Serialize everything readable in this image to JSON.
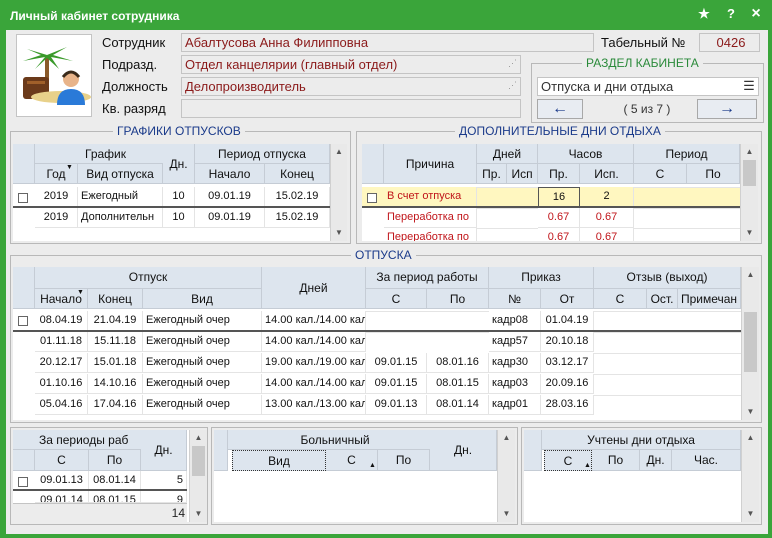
{
  "window": {
    "title": "Личный кабинет сотрудника",
    "icons": [
      "star-icon",
      "help-icon",
      "close-icon"
    ],
    "help": "?",
    "close": "×",
    "star": "★",
    "accent": "#3aa53a"
  },
  "employee": {
    "name_label": "Сотрудник",
    "name": "Абалтусова Анна Филипповна",
    "dept_label": "Подразд.",
    "dept": "Отдел канцелярии (главный отдел)",
    "pos_label": "Должность",
    "pos": "Делопроизводитель",
    "rank_label": "Кв. разряд",
    "rank": "",
    "tab_label": "Табельный №",
    "tab_no": "0426"
  },
  "cabinet": {
    "title": "РАЗДЕЛ КАБИНЕТА",
    "section": "Отпуска и дни отдыха",
    "counter": "( 5 из 7 )",
    "prev": "←",
    "next": "→",
    "menu": "☰"
  },
  "schedules": {
    "title": "ГРАФИКИ ОТПУСКОВ",
    "h_graph": "График",
    "h_year": "Год",
    "h_type": "Вид отпуска",
    "h_days": "Дн.",
    "h_period": "Период отпуска",
    "h_start": "Начало",
    "h_end": "Конец",
    "rows": [
      {
        "year": "2019",
        "type": "Ежегодный",
        "days": "10",
        "start": "09.01.19",
        "end": "15.02.19"
      },
      {
        "year": "2019",
        "type": "Дополнительн",
        "days": "10",
        "start": "09.01.19",
        "end": "15.02.19"
      }
    ]
  },
  "extra": {
    "title": "ДОПОЛНИТЕЛЬНЫЕ ДНИ ОТДЫХА",
    "h_reason": "Причина",
    "h_days": "Дней",
    "h_hours": "Часов",
    "h_period": "Период",
    "h_pr": "Пр.",
    "h_isp": "Исп",
    "h_pr2": "Пр.",
    "h_isp2": "Исп.",
    "h_from": "С",
    "h_to": "По",
    "rows": [
      {
        "reason": "В счет отпуска",
        "d_pr": "",
        "d_isp": "",
        "h_pr": "16",
        "h_isp": "2",
        "from": "",
        "to": ""
      },
      {
        "reason": "Переработка по",
        "d_pr": "",
        "d_isp": "",
        "h_pr": "0.67",
        "h_isp": "0.67",
        "from": "",
        "to": ""
      },
      {
        "reason": "Переработка по",
        "d_pr": "",
        "d_isp": "",
        "h_pr": "0.67",
        "h_isp": "0.67",
        "from": "",
        "to": ""
      }
    ]
  },
  "vac": {
    "title": "ОТПУСКА",
    "h_vac": "Отпуск",
    "h_start": "Начало",
    "h_end": "Конец",
    "h_type": "Вид",
    "h_days": "Дней",
    "h_work": "За период работы",
    "h_from": "С",
    "h_to": "По",
    "h_order": "Приказ",
    "h_no": "№",
    "h_date": "От",
    "h_recall": "Отзыв (выход)",
    "h_rfrom": "С",
    "h_rest": "Ост.",
    "h_note": "Примечан",
    "rows": [
      {
        "start": "08.04.19",
        "end": "21.04.19",
        "type": "Ежегодный очер",
        "days": "14.00 кал./14.00 кал.",
        "wfrom": "",
        "wto": "",
        "no": "кадр08",
        "date": "01.04.19"
      },
      {
        "start": "01.11.18",
        "end": "15.11.18",
        "type": "Ежегодный очер",
        "days": "14.00 кал./14.00 кал.",
        "wfrom": "",
        "wto": "",
        "no": "кадр57",
        "date": "20.10.18"
      },
      {
        "start": "20.12.17",
        "end": "15.01.18",
        "type": "Ежегодный очер",
        "days": "19.00 кал./19.00 кал.",
        "wfrom": "09.01.15",
        "wto": "08.01.16",
        "no": "кадр30",
        "date": "03.12.17"
      },
      {
        "start": "01.10.16",
        "end": "14.10.16",
        "type": "Ежегодный очер",
        "days": "14.00 кал./14.00 кал.",
        "wfrom": "09.01.15",
        "wto": "08.01.15",
        "no": "кадр03",
        "date": "20.09.16"
      },
      {
        "start": "05.04.16",
        "end": "17.04.16",
        "type": "Ежегодный очер",
        "days": "13.00 кал./13.00 кал.",
        "wfrom": "09.01.13",
        "wto": "08.01.14",
        "no": "кадр01",
        "date": "28.03.16"
      }
    ]
  },
  "periods": {
    "h_title": "За периоды раб",
    "h_from": "С",
    "h_to": "По",
    "h_days": "Дн.",
    "total": "14",
    "rows": [
      {
        "from": "09.01.13",
        "to": "08.01.14",
        "days": "5"
      },
      {
        "from": "09.01.14",
        "to": "08.01.15",
        "days": "9"
      }
    ]
  },
  "sick": {
    "h_title": "Больничный",
    "h_type": "Вид",
    "h_from": "С",
    "h_to": "По",
    "h_days": "Дн."
  },
  "rest": {
    "h_title": "Учтены дни отдыха",
    "h_from": "С",
    "h_to": "По",
    "h_days": "Дн.",
    "h_hours": "Час."
  }
}
